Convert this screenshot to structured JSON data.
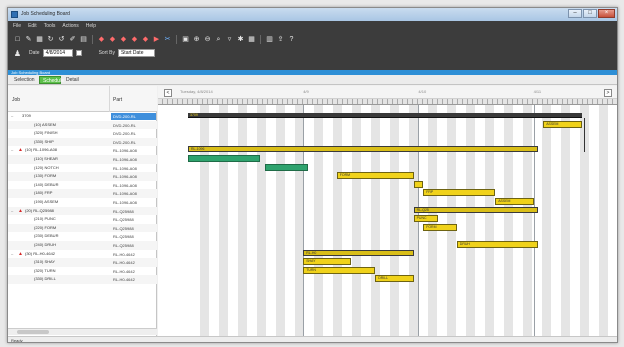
{
  "window": {
    "title": "Job Scheduling Board",
    "controls": [
      "–",
      "□",
      "×"
    ]
  },
  "menu": [
    "File",
    "Edit",
    "Tools",
    "Actions",
    "Help"
  ],
  "toolbar": {
    "icons": [
      {
        "name": "new-icon",
        "glyph": "□",
        "tone": ""
      },
      {
        "name": "open-icon",
        "glyph": "✎",
        "tone": ""
      },
      {
        "name": "save-icon",
        "glyph": "▦",
        "tone": ""
      },
      {
        "name": "refresh-icon",
        "glyph": "↻",
        "tone": ""
      },
      {
        "name": "undo-icon",
        "glyph": "↺",
        "tone": ""
      },
      {
        "name": "edit-icon",
        "glyph": "✐",
        "tone": ""
      },
      {
        "name": "print-icon",
        "glyph": "▤",
        "tone": ""
      },
      {
        "name": "move-up-icon",
        "glyph": "◆",
        "tone": "red"
      },
      {
        "name": "move-down-icon",
        "glyph": "◆",
        "tone": "red"
      },
      {
        "name": "shift-left-icon",
        "glyph": "◆",
        "tone": "red"
      },
      {
        "name": "shift-right-icon",
        "glyph": "◆",
        "tone": "red"
      },
      {
        "name": "lock-icon",
        "glyph": "◆",
        "tone": "red"
      },
      {
        "name": "unlock-icon",
        "glyph": "▶",
        "tone": "red"
      },
      {
        "name": "split-icon",
        "glyph": "✂",
        "tone": "blue"
      },
      {
        "name": "merge-icon",
        "glyph": "▣",
        "tone": ""
      },
      {
        "name": "zoom-in-icon",
        "glyph": "⊕",
        "tone": ""
      },
      {
        "name": "zoom-out-icon",
        "glyph": "⊖",
        "tone": ""
      },
      {
        "name": "search-icon",
        "glyph": "⌕",
        "tone": ""
      },
      {
        "name": "filter-icon",
        "glyph": "▿",
        "tone": ""
      },
      {
        "name": "settings-icon",
        "glyph": "✱",
        "tone": ""
      },
      {
        "name": "calendar-icon",
        "glyph": "▦",
        "tone": ""
      },
      {
        "name": "report-icon",
        "glyph": "▥",
        "tone": ""
      },
      {
        "name": "export-icon",
        "glyph": "⇪",
        "tone": ""
      },
      {
        "name": "help-icon",
        "glyph": "?",
        "tone": ""
      }
    ]
  },
  "filters": {
    "user_icon": "♟",
    "date_label": "Date",
    "date_value": "4/8/2014",
    "sort_label": "Sort By",
    "sort_value": "Start Date"
  },
  "panel_header": "Job Scheduling Board",
  "tabs": [
    {
      "label": "Selection",
      "active": false
    },
    {
      "label": "Schedule",
      "active": true
    },
    {
      "label": "Detail",
      "active": false
    }
  ],
  "grid": {
    "col_job": "Job",
    "col_part": "Part",
    "rows": [
      {
        "job": "3709",
        "part": "DVD-200-RL",
        "level": 0,
        "expand": "–",
        "warn": false,
        "sel": true
      },
      {
        "job": "(10) ASSEM",
        "part": "DVD-200-RL",
        "level": 1,
        "expand": "",
        "warn": false,
        "sel": false
      },
      {
        "job": "(320) FINISH",
        "part": "DVD-200-RL",
        "level": 1,
        "expand": "",
        "warn": false,
        "sel": false
      },
      {
        "job": "(330) SHIP",
        "part": "DVD-200-RL",
        "level": 1,
        "expand": "",
        "warn": false,
        "sel": false
      },
      {
        "job": "(10) RL-1096-A08",
        "part": "RL-1096-A08",
        "level": 0,
        "expand": "–",
        "warn": true,
        "sel": false
      },
      {
        "job": "(110) SHEAR",
        "part": "RL-1096-A08",
        "level": 1,
        "expand": "",
        "warn": false,
        "sel": false
      },
      {
        "job": "(120) NOTCH",
        "part": "RL-1096-A08",
        "level": 1,
        "expand": "",
        "warn": false,
        "sel": false
      },
      {
        "job": "(130) FORM",
        "part": "RL-1096-A08",
        "level": 1,
        "expand": "",
        "warn": false,
        "sel": false
      },
      {
        "job": "(140) DEBUR",
        "part": "RL-1096-A08",
        "level": 1,
        "expand": "",
        "warn": false,
        "sel": false
      },
      {
        "job": "(180) FRP",
        "part": "RL-1096-A08",
        "level": 1,
        "expand": "",
        "warn": false,
        "sel": false
      },
      {
        "job": "(190) ASSEM",
        "part": "RL-1096-A08",
        "level": 1,
        "expand": "",
        "warn": false,
        "sel": false
      },
      {
        "job": "(20) RL-Q25988",
        "part": "RL-Q25988",
        "level": 0,
        "expand": "–",
        "warn": true,
        "sel": false
      },
      {
        "job": "(210) PUNC",
        "part": "RL-Q25988",
        "level": 1,
        "expand": "",
        "warn": false,
        "sel": false
      },
      {
        "job": "(220) FORM",
        "part": "RL-Q25988",
        "level": 1,
        "expand": "",
        "warn": false,
        "sel": false
      },
      {
        "job": "(230) DEBUR",
        "part": "RL-Q25988",
        "level": 1,
        "expand": "",
        "warn": false,
        "sel": false
      },
      {
        "job": "(240) DRUH",
        "part": "RL-Q25988",
        "level": 1,
        "expand": "",
        "warn": false,
        "sel": false
      },
      {
        "job": "(30) RL-H0-4642",
        "part": "RL-H0-4642",
        "level": 0,
        "expand": "–",
        "warn": true,
        "sel": false
      },
      {
        "job": "(310) SHAY",
        "part": "RL-H0-4642",
        "level": 1,
        "expand": "",
        "warn": false,
        "sel": false
      },
      {
        "job": "(320) TURN",
        "part": "RL-H0-4642",
        "level": 1,
        "expand": "",
        "warn": false,
        "sel": false
      },
      {
        "job": "(330) DRILL",
        "part": "RL-H0-4642",
        "level": 1,
        "expand": "",
        "warn": false,
        "sel": false
      }
    ]
  },
  "gantt": {
    "start_date": "Tuesday, 4/8/2014",
    "date_markers": [
      {
        "label": "4/9",
        "col": 24
      },
      {
        "label": "4/10",
        "col": 48
      },
      {
        "label": "4/11",
        "col": 72
      }
    ],
    "bars": [
      {
        "row": 0,
        "start": 0,
        "end": 82,
        "kind": "summary-dark",
        "label": "3709"
      },
      {
        "row": 1,
        "start": 74,
        "end": 82,
        "kind": "yellow",
        "label": "ASSEM"
      },
      {
        "row": 4,
        "start": 0,
        "end": 73,
        "kind": "summary-gold",
        "label": "RL-1096"
      },
      {
        "row": 5,
        "start": 0,
        "end": 15,
        "kind": "green",
        "label": ""
      },
      {
        "row": 6,
        "start": 16,
        "end": 25,
        "kind": "green",
        "label": ""
      },
      {
        "row": 7,
        "start": 31,
        "end": 47,
        "kind": "yellow",
        "label": "FORM"
      },
      {
        "row": 8,
        "start": 47,
        "end": 49,
        "kind": "yellow",
        "label": ""
      },
      {
        "row": 9,
        "start": 49,
        "end": 64,
        "kind": "yellow",
        "label": "FRP"
      },
      {
        "row": 10,
        "start": 64,
        "end": 72,
        "kind": "yellow",
        "label": "ASSEM"
      },
      {
        "row": 11,
        "start": 47,
        "end": 73,
        "kind": "summary-gold",
        "label": "RL-Q25"
      },
      {
        "row": 12,
        "start": 47,
        "end": 52,
        "kind": "yellow",
        "label": "PUNC"
      },
      {
        "row": 13,
        "start": 49,
        "end": 56,
        "kind": "yellow",
        "label": "FORM"
      },
      {
        "row": 15,
        "start": 56,
        "end": 73,
        "kind": "yellow",
        "label": "DRUH"
      },
      {
        "row": 16,
        "start": 24,
        "end": 47,
        "kind": "summary-gold",
        "label": "RL-H0"
      },
      {
        "row": 17,
        "start": 24,
        "end": 34,
        "kind": "yellow",
        "label": "SHAY"
      },
      {
        "row": 18,
        "start": 24,
        "end": 39,
        "kind": "yellow",
        "label": "TURN"
      },
      {
        "row": 19,
        "start": 39,
        "end": 47,
        "kind": "yellow",
        "label": "DRILL"
      }
    ]
  },
  "status": "Ready",
  "colors": {
    "toolbar_bg": "#3c3c3c",
    "panel_header": "#2e8fd6",
    "tab_active": "#5cc04a",
    "bar_yellow": "#f0d21a",
    "bar_green": "#2fa36e",
    "selected_row": "#3f8fdc"
  }
}
